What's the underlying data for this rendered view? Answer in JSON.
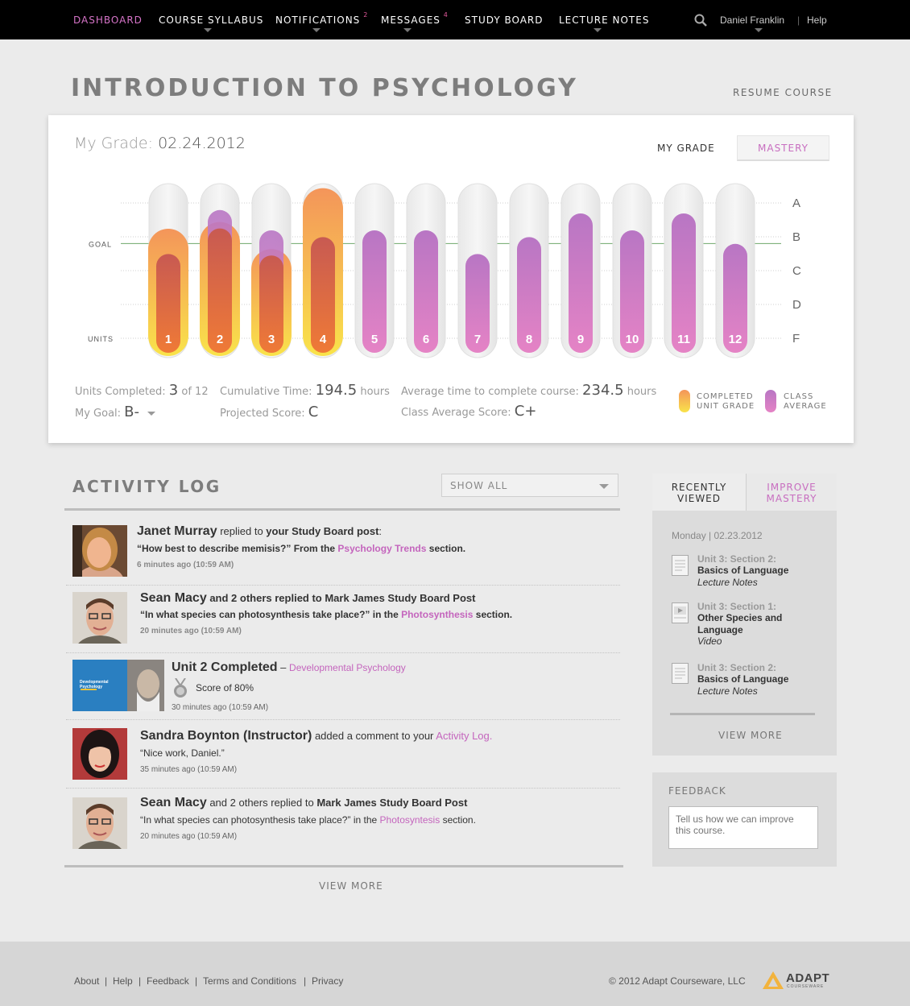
{
  "nav": {
    "items": [
      {
        "label": "DASHBOARD",
        "active": true
      },
      {
        "label": "COURSE SYLLABUS",
        "caret": true
      },
      {
        "label": "NOTIFICATIONS",
        "badge": "2",
        "caret": true
      },
      {
        "label": "MESSAGES",
        "badge": "4",
        "caret": true
      },
      {
        "label": "STUDY BOARD"
      },
      {
        "label": "LECTURE NOTES",
        "caret": true
      }
    ],
    "search_icon": "search-icon",
    "user_name": "Daniel Franklin",
    "separator": "|",
    "help": "Help"
  },
  "header": {
    "title": "INTRODUCTION TO PSYCHOLOGY",
    "resume": "RESUME COURSE"
  },
  "grade_card": {
    "title_prefix": "My Grade:",
    "date": "02.24.2012",
    "tab_my_grade": "MY GRADE",
    "tab_mastery": "MASTERY",
    "stats": {
      "units_completed_label": "Units Completed:",
      "units_completed_value": "3",
      "units_completed_total": "of 12",
      "my_goal_label": "My Goal:",
      "my_goal_value": "B-",
      "cumulative_time_label": "Cumulative Time:",
      "cumulative_time_value": "194.5",
      "cumulative_time_unit": "hours",
      "projected_score_label": "Projected Score:",
      "projected_score_value": "C",
      "avg_time_label": "Average time to complete course:",
      "avg_time_value": "234.5",
      "avg_time_unit": "hours",
      "class_avg_label": "Class Average Score:",
      "class_avg_value": "C+"
    },
    "legend": {
      "completed_line1": "COMPLETED",
      "completed_line2": "UNIT GRADE",
      "class_line1": "CLASS",
      "class_line2": "AVERAGE"
    },
    "colors": {
      "completed_top": "#f4955a",
      "completed_bottom": "#f9e34a",
      "class_top": "#b876c4",
      "class_bottom": "#e583c5",
      "goal_line": "#6ea86a"
    }
  },
  "chart_data": {
    "type": "bar",
    "categories": [
      "1",
      "2",
      "3",
      "4",
      "5",
      "6",
      "7",
      "8",
      "9",
      "10",
      "11",
      "12"
    ],
    "grade_scale": [
      "F",
      "D",
      "C",
      "B",
      "A"
    ],
    "ylim": [
      0,
      4
    ],
    "goal_label": "GOAL",
    "goal_value": 2.8,
    "units_label": "UNITS",
    "series": [
      {
        "name": "COMPLETED UNIT GRADE",
        "values": [
          3.0,
          3.2,
          2.4,
          4.2,
          null,
          null,
          null,
          null,
          null,
          null,
          null,
          null
        ]
      },
      {
        "name": "CLASS AVERAGE",
        "values": [
          2.3,
          3.6,
          3.0,
          2.8,
          3.0,
          3.0,
          2.3,
          2.8,
          3.5,
          3.0,
          3.5,
          2.6
        ]
      }
    ]
  },
  "activity": {
    "title": "ACTIVITY LOG",
    "filter": "SHOW ALL",
    "entries": [
      {
        "name": "Janet Murray",
        "action": " replied to ",
        "action_bold": "your Study Board post",
        "action_end": ":",
        "quote": "“How best to describe memisis?” From the ",
        "link": "Psychology Trends",
        "quote_end": " section.",
        "time": "6 minutes ago (10:59 AM)"
      },
      {
        "name": "Sean Macy",
        "action": " and 2 others replied to Mark James Study Board Post",
        "quote": "“In what species can photosynthesis take place?” in the ",
        "link": "Photosynthesis",
        "quote_end": " section.",
        "time": "20 minutes ago (10:59 AM)"
      },
      {
        "name": "Unit 2 Completed",
        "dash": " – ",
        "link": "Developmental Psychology",
        "thumb_title": "Developmental Psychology",
        "score": "Score of 80%",
        "medal_icon": "medal-icon",
        "time": "30 minutes ago (10:59 AM)"
      },
      {
        "name": "Sandra Boynton (Instructor)",
        "action": " added a comment to your ",
        "link": "Activity Log.",
        "quote": "“Nice work, Daniel.”",
        "time": "35 minutes ago (10:59 AM)"
      },
      {
        "name": "Sean Macy",
        "action": " and 2 others replied to ",
        "action_bold": "Mark James Study Board Post",
        "quote": "“In what species can photosynthesis take place?” in the ",
        "link": "Photosyntesis",
        "quote_end": " section.",
        "time": "20 minutes ago (10:59 AM)"
      }
    ],
    "view_more": "VIEW MORE"
  },
  "sidebar": {
    "tab_recent_1": "RECENTLY",
    "tab_recent_2": "VIEWED",
    "tab_improve_1": "IMPROVE",
    "tab_improve_2": "MASTERY",
    "date": "Monday | 02.23.2012",
    "items": [
      {
        "section": "Unit 3: Section 2:",
        "title1": "Basics of Language",
        "title2": "",
        "type": "Lecture Notes",
        "icon": "document-icon"
      },
      {
        "section": "Unit 3: Section 1:",
        "title1": "Other Species and",
        "title2": "Language",
        "type": "Video",
        "icon": "video-icon"
      },
      {
        "section": "Unit 3: Section 2:",
        "title1": "Basics of Language",
        "title2": "",
        "type": "Lecture Notes",
        "icon": "document-icon"
      }
    ],
    "view_more": "VIEW MORE",
    "feedback_title": "FEEDBACK",
    "feedback_placeholder": "Tell us how we can improve this course."
  },
  "footer": {
    "links": [
      "About",
      "Help",
      "Feedback",
      "Terms and Conditions",
      "Privacy"
    ],
    "separator": "|",
    "copyright": "© 2012 Adapt Courseware, LLC",
    "logo_text": "ADAPT",
    "logo_sub": "COURSEWARE"
  }
}
